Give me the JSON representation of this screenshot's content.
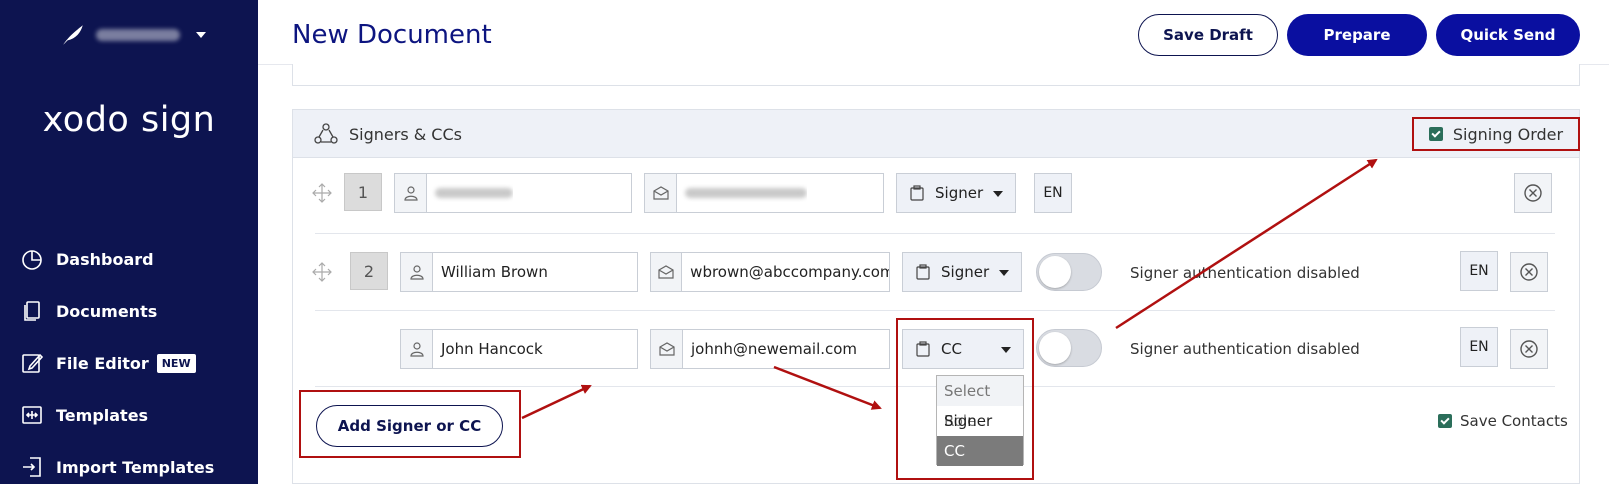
{
  "brand": {
    "name": "xodo sign"
  },
  "nav": {
    "items": [
      {
        "label": "Dashboard",
        "icon": "pie-chart-icon"
      },
      {
        "label": "Documents",
        "icon": "documents-icon"
      },
      {
        "label": "File Editor",
        "icon": "edit-icon",
        "badge": "NEW"
      },
      {
        "label": "Templates",
        "icon": "templates-icon"
      },
      {
        "label": "Import Templates",
        "icon": "import-icon"
      }
    ]
  },
  "header": {
    "title": "New Document",
    "save_draft": "Save Draft",
    "prepare": "Prepare",
    "quick_send": "Quick Send"
  },
  "signers_panel": {
    "title": "Signers & CCs",
    "signing_order_label": "Signing Order",
    "signing_order_checked": true,
    "rows": [
      {
        "order": "1",
        "name": "",
        "email": "",
        "role": "Signer",
        "lang": "EN",
        "auth_text": ""
      },
      {
        "order": "2",
        "name": "William Brown",
        "email": "wbrown@abccompany.com",
        "role": "Signer",
        "lang": "EN",
        "auth_text": "Signer authentication disabled"
      },
      {
        "order": "",
        "name": "John Hancock",
        "email": "johnh@newemail.com",
        "role": "CC",
        "lang": "EN",
        "auth_text": "Signer authentication disabled"
      }
    ],
    "role_dropdown": {
      "options": [
        "Select Role",
        "Signer",
        "CC"
      ],
      "selected": "CC"
    },
    "add_button": "Add Signer or CC",
    "save_contacts_label": "Save Contacts",
    "save_contacts_checked": true
  },
  "colors": {
    "sidebar_bg": "#0d1450",
    "primary_button": "#0a0fa0",
    "annotation_red": "#b01010",
    "checkbox_green": "#2b6e5a"
  }
}
